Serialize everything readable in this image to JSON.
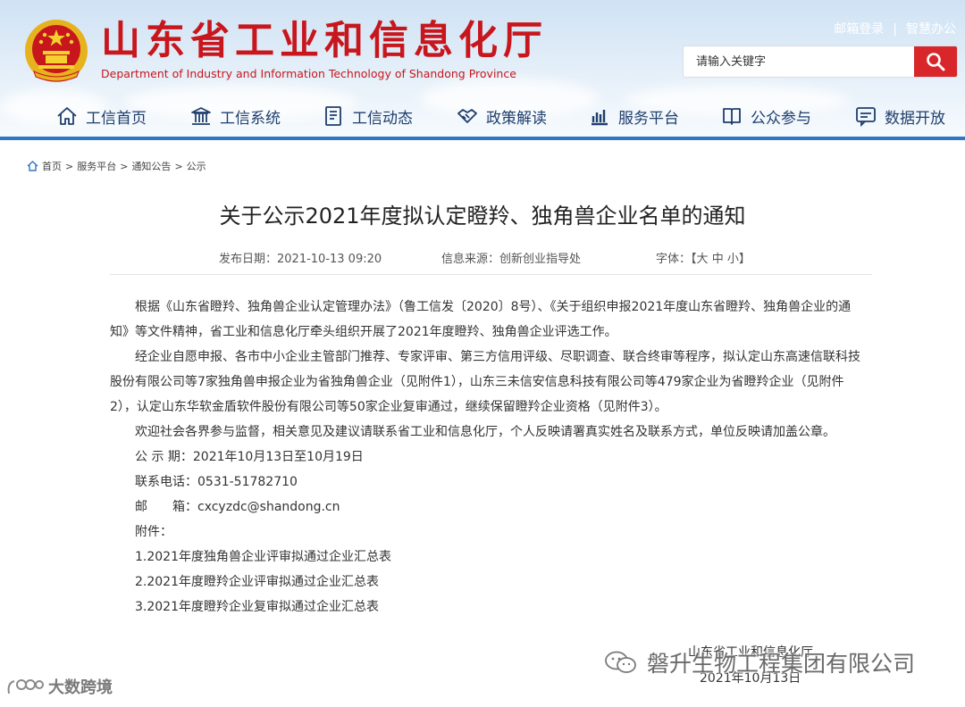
{
  "header": {
    "title_cn": "山东省工业和信息化厅",
    "title_en": "Department of Industry and Information Technology of Shandong Province",
    "top_links": [
      "邮箱登录",
      "智慧办公"
    ],
    "top_link_separator": "|",
    "search": {
      "placeholder": "请输入关键字"
    }
  },
  "nav": {
    "items": [
      {
        "label": "工信首页",
        "icon": "home-icon"
      },
      {
        "label": "工信系统",
        "icon": "building-icon"
      },
      {
        "label": "工信动态",
        "icon": "news-icon"
      },
      {
        "label": "政策解读",
        "icon": "handshake-icon"
      },
      {
        "label": "服务平台",
        "icon": "chart-icon"
      },
      {
        "label": "公众参与",
        "icon": "book-icon"
      },
      {
        "label": "数据开放",
        "icon": "chat-icon"
      }
    ]
  },
  "breadcrumb": {
    "items": [
      "首页",
      "服务平台",
      "通知公告",
      "公示"
    ],
    "separator": ">"
  },
  "article": {
    "title": "关于公示2021年度拟认定瞪羚、独角兽企业名单的通知",
    "publish_date": "发布日期：2021-10-13 09:20",
    "source": "信息来源：创新创业指导处",
    "font_size_label": "字体：",
    "font_sizes": [
      "大",
      "中",
      "小"
    ],
    "paragraphs": [
      "根据《山东省瞪羚、独角兽企业认定管理办法》（鲁工信发〔2020〕8号）、《关于组织申报2021年度山东省瞪羚、独角兽企业的通知》等文件精神，省工业和信息化厅牵头组织开展了2021年度瞪羚、独角兽企业评选工作。",
      "经企业自愿申报、各市中小企业主管部门推荐、专家评审、第三方信用评级、尽职调查、联合终审等程序，拟认定山东高速信联科技股份有限公司等7家独角兽申报企业为省独角兽企业（见附件1），山东三未信安信息科技有限公司等479家企业为省瞪羚企业（见附件2），认定山东华软金盾软件股份有限公司等50家企业复审通过，继续保留瞪羚企业资格（见附件3）。",
      "欢迎社会各界参与监督，相关意见及建议请联系省工业和信息化厅，个人反映请署真实姓名及联系方式，单位反映请加盖公章。"
    ],
    "period": "公 示 期：2021年10月13日至10月19日",
    "phone": "联系电话：0531-51782710",
    "email": "邮　　箱：cxcyzdc@shandong.cn",
    "attachments_label": "附件：",
    "attachments": [
      "1.2021年度独角兽企业评审拟通过企业汇总表",
      "2.2021年度瞪羚企业评审拟通过企业汇总表",
      "3.2021年度瞪羚企业复审拟通过企业汇总表"
    ],
    "signature_org": "山东省工业和信息化厅",
    "signature_date": "2021年10月13日"
  },
  "watermarks": {
    "right": "磐升生物工程集团有限公司",
    "left": "大数跨境"
  },
  "colors": {
    "brand_red": "#c8161d",
    "nav_text": "#1f3e6d",
    "nav_bar": "#2c77c8",
    "search_button": "#d8262a"
  }
}
